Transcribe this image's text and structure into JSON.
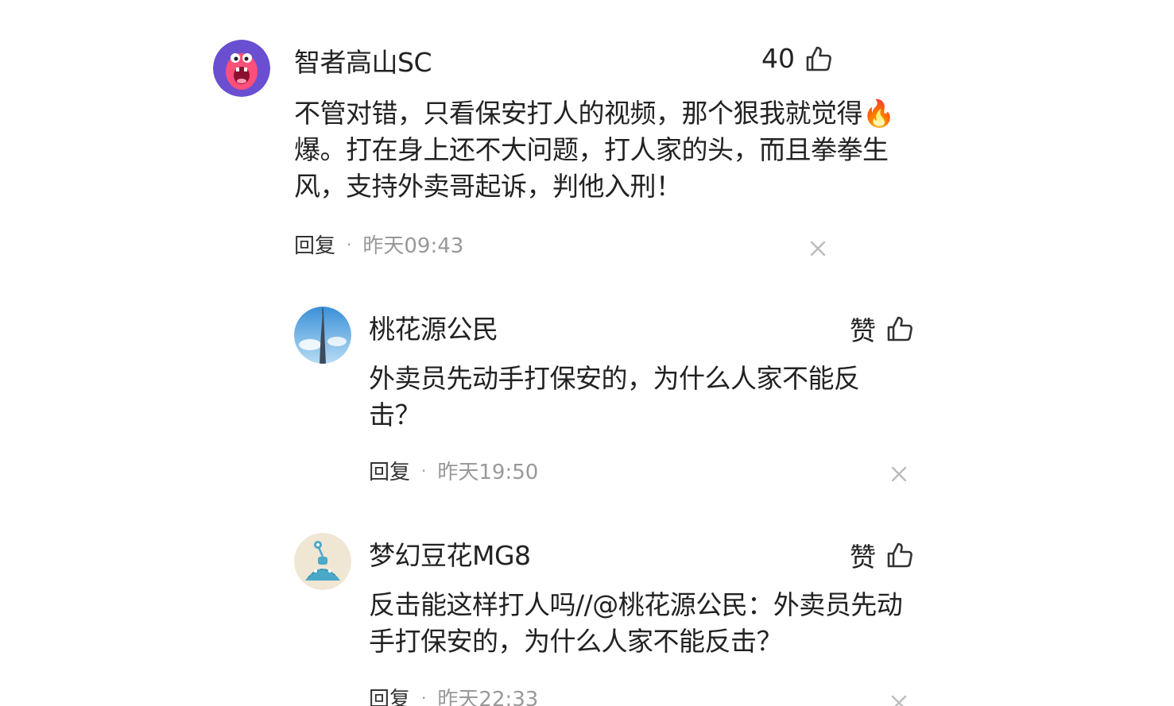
{
  "comments": [
    {
      "user": "智者高山SC",
      "like": "40",
      "text_lines": [
        "不管对错，只看保安打人的视频，那个狠我就觉得",
        "爆。打在身上还不大问题，打人家的头，而且拳拳生",
        "风，支持外卖哥起诉，判他入刑！"
      ],
      "inline_emoji": "🔥",
      "reply_label": "回复",
      "separator": "·",
      "time": "昨天09:43"
    },
    {
      "user": "桃花源公民",
      "like": "赞",
      "text_lines": [
        "外卖员先动手打保安的，为什么人家不能反",
        "击？"
      ],
      "reply_label": "回复",
      "separator": "·",
      "time": "昨天19:50"
    },
    {
      "user": "梦幻豆花MG8",
      "like": "赞",
      "text_lines": [
        "反击能这样打人吗//@桃花源公民：外卖员先动",
        "手打保安的，为什么人家不能反击？"
      ],
      "reply_label": "回复",
      "separator": "·",
      "time": "昨天22:33"
    }
  ],
  "icons": {
    "like": "thumbs-up-icon",
    "close": "close-icon",
    "fire": "fire-emoji"
  },
  "colors": {
    "text": "#222222",
    "muted": "#999999",
    "avatar1_bg": "#6a4fd0",
    "avatar1_face": "#ff4f7a"
  }
}
